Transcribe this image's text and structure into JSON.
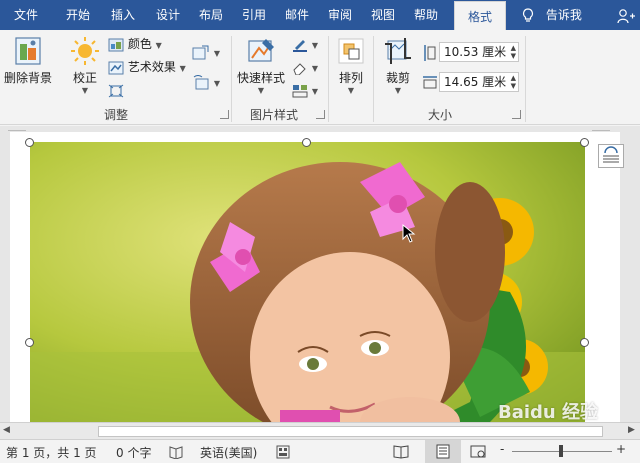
{
  "tabs": {
    "file": "文件",
    "home": "开始",
    "insert": "插入",
    "design": "设计",
    "layout": "布局",
    "references": "引用",
    "mailings": "邮件",
    "review": "审阅",
    "view": "视图",
    "help": "帮助",
    "format": "格式",
    "tell_me": "告诉我"
  },
  "ribbon": {
    "remove_bg": "删除背景",
    "corrections": "校正",
    "color": "颜色",
    "artistic": "艺术效果",
    "group_adjust": "调整",
    "quick_styles": "快速样式",
    "group_styles": "图片样式",
    "arrange": "排列",
    "crop": "裁剪",
    "height": "10.53 厘米",
    "width": "14.65 厘米",
    "group_size": "大小"
  },
  "status": {
    "page": "第 1 页，共 1 页",
    "words": "0 个字",
    "language": "英语(美国)",
    "zoom_minus": "-",
    "zoom_plus": "+"
  },
  "colors": {
    "accent": "#2b579a"
  },
  "watermark": "Baidu 经验"
}
